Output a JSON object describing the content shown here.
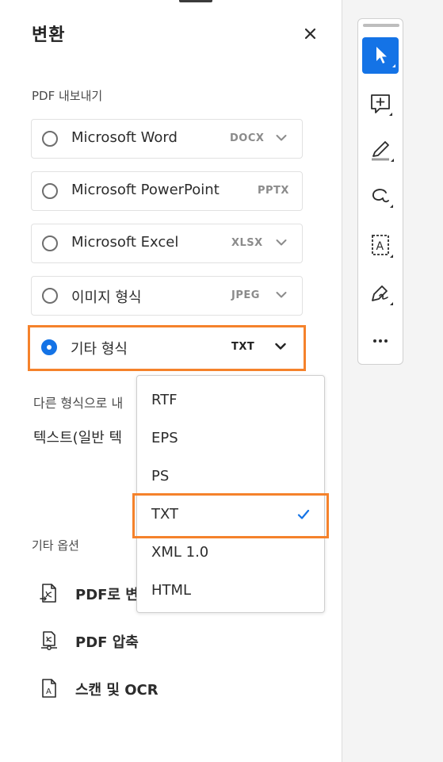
{
  "panel": {
    "title": "변환",
    "export_section_label": "PDF 내보내기",
    "options": [
      {
        "name": "Microsoft Word",
        "format": "DOCX",
        "has_dropdown": true,
        "selected": false
      },
      {
        "name": "Microsoft PowerPoint",
        "format": "PPTX",
        "has_dropdown": false,
        "selected": false
      },
      {
        "name": "Microsoft Excel",
        "format": "XLSX",
        "has_dropdown": true,
        "selected": false
      },
      {
        "name": "이미지 형식",
        "format": "JPEG",
        "has_dropdown": true,
        "selected": false
      },
      {
        "name": "기타 형식",
        "format": "TXT",
        "has_dropdown": true,
        "selected": true
      }
    ],
    "convert_to_label": "다른 형식으로 내",
    "convert_to_value": "텍스트(일반 텍",
    "other_options_label": "기타 옵션",
    "tools": [
      {
        "label": "PDF로 변",
        "icon": "pdf-convert-icon"
      },
      {
        "label": "PDF 압축",
        "icon": "pdf-compress-icon"
      },
      {
        "label": "스캔 및 OCR",
        "icon": "scan-ocr-icon"
      }
    ]
  },
  "dropdown": {
    "items": [
      "RTF",
      "EPS",
      "PS",
      "TXT",
      "XML 1.0",
      "HTML"
    ],
    "selected": "TXT"
  },
  "toolbar": {
    "tools": [
      "select-cursor-icon",
      "add-comment-icon",
      "highlight-icon",
      "draw-freeform-icon",
      "text-select-icon",
      "sign-icon",
      "more-icon"
    ]
  },
  "colors": {
    "accent": "#1473e6",
    "highlight": "#f5822b",
    "text": "#2c2c2c",
    "muted": "#8b8b8b"
  }
}
